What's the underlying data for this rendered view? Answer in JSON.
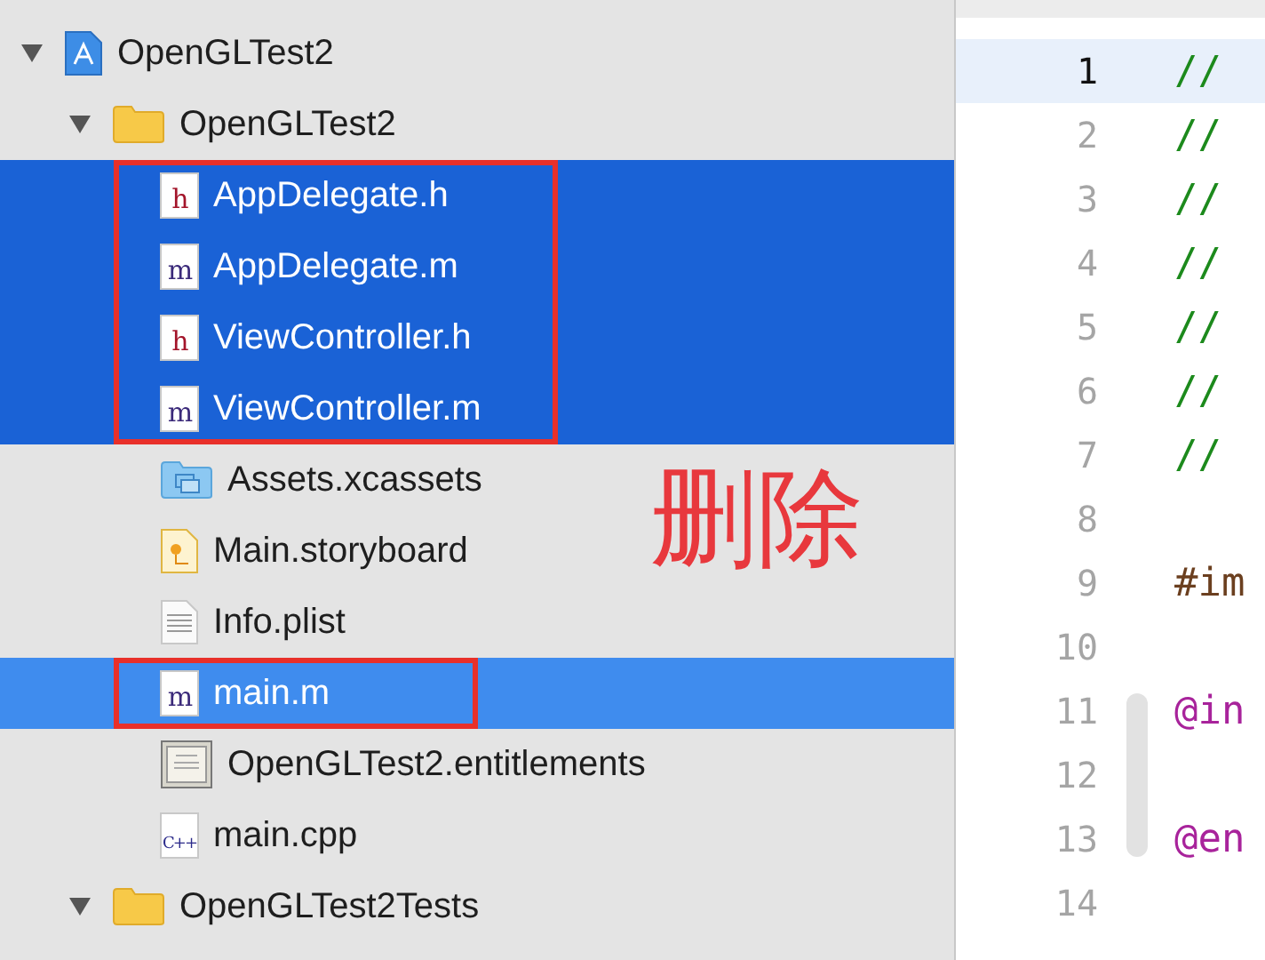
{
  "navigator": {
    "tree": [
      {
        "name": "OpenGLTest2",
        "kind": "project",
        "expanded": true,
        "selected": false,
        "active": false,
        "children": [
          {
            "name": "OpenGLTest2",
            "kind": "folder",
            "expanded": true,
            "selected": false,
            "active": false,
            "children": [
              {
                "name": "AppDelegate.h",
                "kind": "source",
                "icon_text": "h",
                "selected": true,
                "active": false,
                "boxed": true
              },
              {
                "name": "AppDelegate.m",
                "kind": "source",
                "icon_text": "m",
                "selected": true,
                "active": false,
                "boxed": true
              },
              {
                "name": "ViewController.h",
                "kind": "source",
                "icon_text": "h",
                "selected": true,
                "active": false,
                "boxed": true
              },
              {
                "name": "ViewController.m",
                "kind": "source",
                "icon_text": "m",
                "selected": true,
                "active": false,
                "boxed": true
              },
              {
                "name": "Assets.xcassets",
                "kind": "assets",
                "selected": false,
                "active": false
              },
              {
                "name": "Main.storyboard",
                "kind": "storyboard",
                "selected": false,
                "active": false
              },
              {
                "name": "Info.plist",
                "kind": "plist",
                "selected": false,
                "active": false
              },
              {
                "name": "main.m",
                "kind": "source",
                "icon_text": "m",
                "selected": true,
                "active": true,
                "boxed": true
              },
              {
                "name": "OpenGLTest2.entitlements",
                "kind": "entitlements",
                "selected": false,
                "active": false
              },
              {
                "name": "main.cpp",
                "kind": "source",
                "icon_text": "C++",
                "selected": false,
                "active": false
              }
            ]
          },
          {
            "name": "OpenGLTest2Tests",
            "kind": "folder",
            "expanded": true,
            "selected": false,
            "active": false
          }
        ]
      }
    ],
    "annotation": "删除"
  },
  "editor": {
    "lines": [
      {
        "number": "1",
        "text": "//",
        "kind": "comment",
        "current": true
      },
      {
        "number": "2",
        "text": "//",
        "kind": "comment",
        "current": false
      },
      {
        "number": "3",
        "text": "//",
        "kind": "comment",
        "current": false
      },
      {
        "number": "4",
        "text": "//",
        "kind": "comment",
        "current": false
      },
      {
        "number": "5",
        "text": "//",
        "kind": "comment",
        "current": false
      },
      {
        "number": "6",
        "text": "//",
        "kind": "comment",
        "current": false
      },
      {
        "number": "7",
        "text": "//",
        "kind": "comment",
        "current": false
      },
      {
        "number": "8",
        "current": false
      },
      {
        "number": "9",
        "text": "#im",
        "kind": "directive",
        "current": false
      },
      {
        "number": "10",
        "current": false
      },
      {
        "number": "11",
        "text": "@in",
        "kind": "keyword",
        "current": false,
        "in_fold": true
      },
      {
        "number": "12",
        "current": false,
        "in_fold": true
      },
      {
        "number": "13",
        "text": "@en",
        "kind": "keyword",
        "current": false,
        "in_fold": true
      },
      {
        "number": "14",
        "current": false
      }
    ]
  }
}
